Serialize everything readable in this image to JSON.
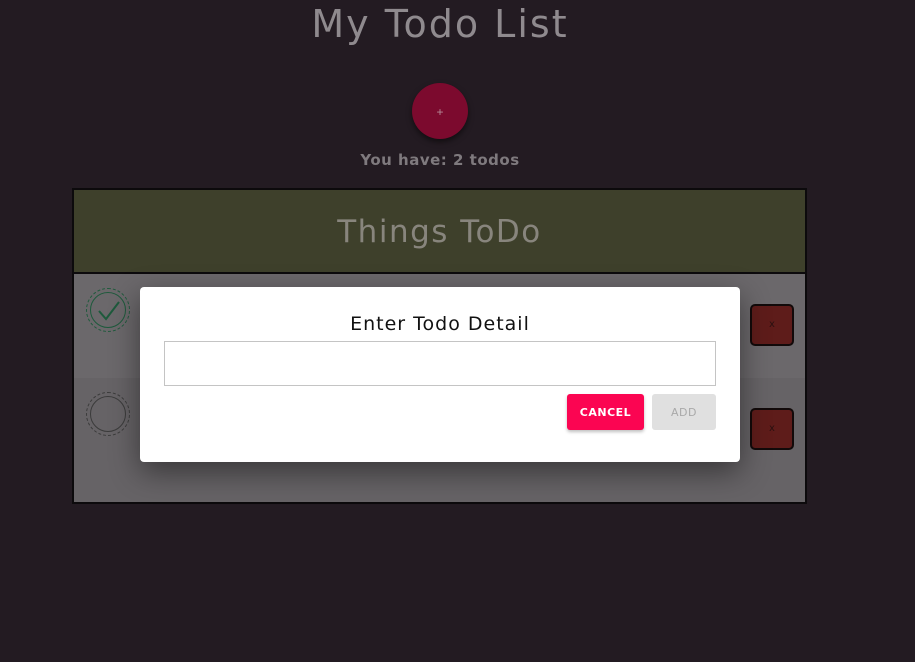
{
  "app": {
    "title": "My Todo List",
    "add_button_label": "+",
    "todo_count_text": "You have: 2 todos"
  },
  "list": {
    "header": "Things ToDo",
    "items": [
      {
        "completed": true,
        "delete_label": "x"
      },
      {
        "completed": false,
        "delete_label": "x"
      }
    ]
  },
  "dialog": {
    "title": "Enter Todo Detail",
    "input_value": "",
    "cancel_label": "CANCEL",
    "add_label": "ADD",
    "add_disabled": true
  },
  "colors": {
    "background": "#231b22",
    "header_bg": "#3e402b",
    "accent_pink": "#fb0552",
    "delete_red": "#5e1c1a",
    "check_green": "#1e5a3c"
  },
  "icons": {
    "complete": "checkmark-icon",
    "incomplete": "empty-circle-icon"
  }
}
